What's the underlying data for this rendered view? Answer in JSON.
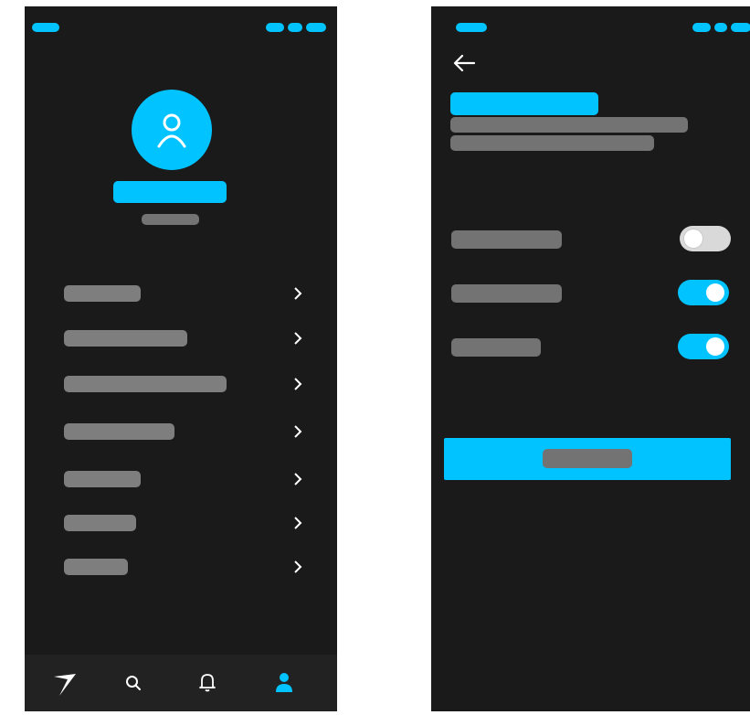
{
  "colors": {
    "accent": "#00c3ff",
    "background": "#1a1a1a",
    "placeholder": "#737373",
    "placeholder_light": "#7e7e7e",
    "toggle_off": "#d9d9d9",
    "toggle_off_knob": "#ffffff",
    "navbar": "#222222",
    "icon": "#ffffff"
  },
  "profile_screen": {
    "avatar_icon": "user-outline-icon",
    "menu_items": [
      {
        "icon": "chevron-right-icon"
      },
      {
        "icon": "chevron-right-icon"
      },
      {
        "icon": "chevron-right-icon"
      },
      {
        "icon": "chevron-right-icon"
      },
      {
        "icon": "chevron-right-icon"
      },
      {
        "icon": "chevron-right-icon"
      },
      {
        "icon": "chevron-right-icon"
      }
    ],
    "bottom_nav": [
      {
        "icon": "logo-swoosh-icon",
        "active": false
      },
      {
        "icon": "search-icon",
        "active": false
      },
      {
        "icon": "bell-icon",
        "active": false
      },
      {
        "icon": "person-icon",
        "active": true
      }
    ]
  },
  "settings_screen": {
    "back_icon": "arrow-left-icon",
    "toggles": [
      {
        "on": false
      },
      {
        "on": true
      },
      {
        "on": true
      }
    ]
  }
}
